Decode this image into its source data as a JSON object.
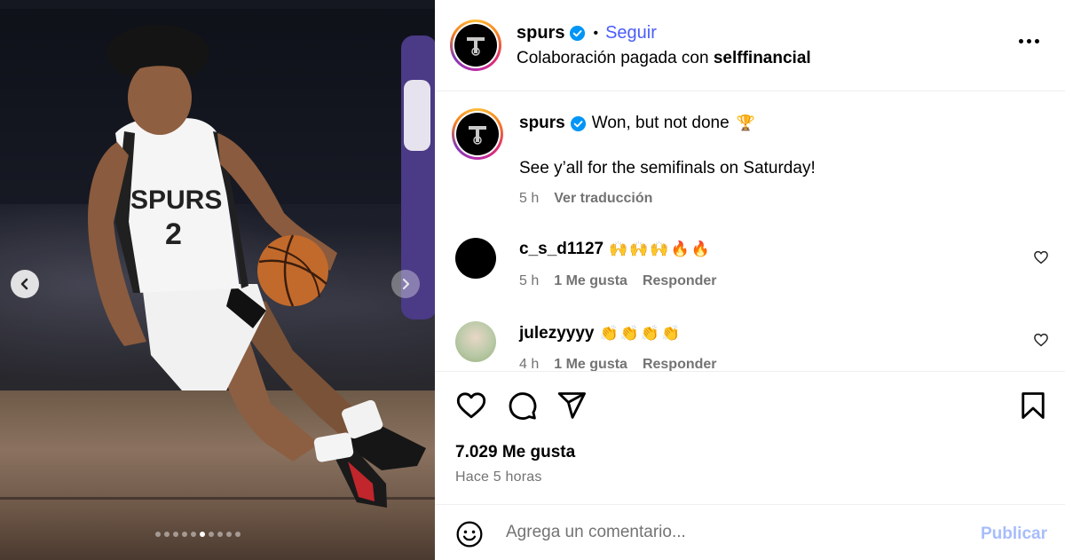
{
  "post": {
    "username": "spurs",
    "follow_label": "Seguir",
    "separator": "•",
    "collab_prefix": "Colaboración pagada con",
    "collab_partner": "selffinancial"
  },
  "caption": {
    "username": "spurs",
    "text_line1": "Won, but not done",
    "text_line1_emoji": "🏆",
    "text_line2": "See y’all for the semifinals on Saturday!",
    "time": "5 h",
    "translate_label": "Ver traducción"
  },
  "comments": [
    {
      "username": "c_s_d1127",
      "emojis": "🙌🙌🙌🔥🔥",
      "time": "5 h",
      "likes": "1 Me gusta",
      "reply_label": "Responder"
    },
    {
      "username": "julezyyyy",
      "emojis": "👏👏👏👏",
      "time": "4 h",
      "likes": "1 Me gusta",
      "reply_label": "Responder"
    }
  ],
  "actions": {
    "like_icon": "heart-icon",
    "comment_icon": "comment-icon",
    "share_icon": "share-icon",
    "save_icon": "bookmark-icon"
  },
  "stats": {
    "likes": "7.029 Me gusta",
    "posted": "Hace 5 horas"
  },
  "composer": {
    "placeholder": "Agrega un comentario...",
    "publish_label": "Publicar"
  },
  "carousel": {
    "total": 10,
    "active_index": 5
  },
  "colors": {
    "accent": "#4a5df9",
    "publish_disabled": "#a7bdfb",
    "verified": "#0095f6",
    "muted": "#737373"
  }
}
